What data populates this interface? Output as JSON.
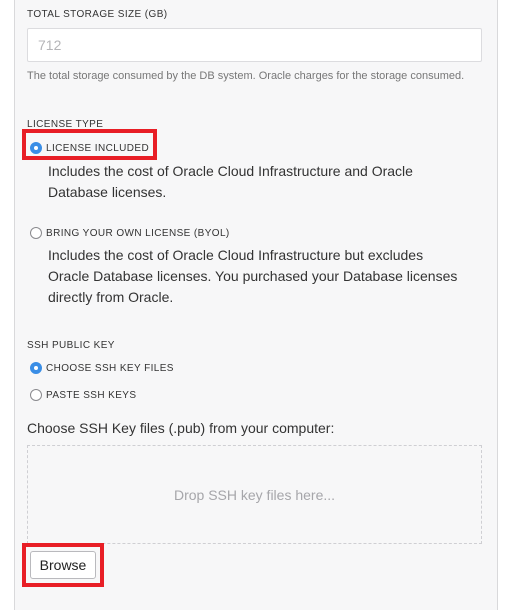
{
  "storage": {
    "label": "TOTAL STORAGE SIZE (GB)",
    "value": "712",
    "help": "The total storage consumed by the DB system. Oracle charges for the storage consumed."
  },
  "license": {
    "label": "LICENSE TYPE",
    "options": [
      {
        "label": "LICENSE INCLUDED",
        "description": "Includes the cost of Oracle Cloud Infrastructure and Oracle Database licenses.",
        "selected": true
      },
      {
        "label": "BRING YOUR OWN LICENSE (BYOL)",
        "description": "Includes the cost of Oracle Cloud Infrastructure but excludes Oracle Database licenses. You purchased your Database licenses directly from Oracle.",
        "selected": false
      }
    ]
  },
  "ssh": {
    "label": "SSH PUBLIC KEY",
    "options": [
      {
        "label": "CHOOSE SSH KEY FILES",
        "selected": true
      },
      {
        "label": "PASTE SSH KEYS",
        "selected": false
      }
    ],
    "choose_label": "Choose SSH Key files (.pub) from your computer:",
    "drop_text": "Drop SSH key files here...",
    "browse_label": "Browse"
  },
  "colors": {
    "accent": "#3a8ee6",
    "highlight": "#e81e26"
  }
}
